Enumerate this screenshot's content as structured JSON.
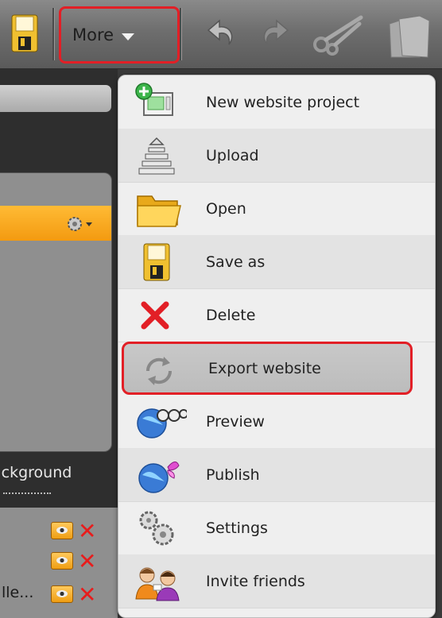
{
  "toolbar": {
    "more_label": "More",
    "icons": [
      "save-icon",
      "more-chevron-down-icon",
      "undo-icon",
      "redo-icon",
      "cut-icon",
      "paste-icon"
    ]
  },
  "left_panel": {
    "background_label": "ackground",
    "rows": [
      {
        "label": ""
      },
      {
        "label": ""
      },
      {
        "label": "lle..."
      }
    ]
  },
  "menu": {
    "items": [
      {
        "label": "New website project",
        "icon": "new-project-icon"
      },
      {
        "label": "Upload",
        "icon": "upload-icon"
      },
      {
        "label": "Open",
        "icon": "folder-icon"
      },
      {
        "label": "Save as",
        "icon": "save-icon"
      },
      {
        "label": "Delete",
        "icon": "delete-icon"
      },
      {
        "label": "Export website",
        "icon": "export-icon"
      },
      {
        "label": "Preview",
        "icon": "binoculars-icon"
      },
      {
        "label": "Publish",
        "icon": "globe-butterfly-icon"
      },
      {
        "label": "Settings",
        "icon": "gears-icon"
      },
      {
        "label": "Invite friends",
        "icon": "people-icon"
      }
    ]
  },
  "colors": {
    "highlight_border": "#e21f26",
    "accent_orange": "#f39a10"
  }
}
